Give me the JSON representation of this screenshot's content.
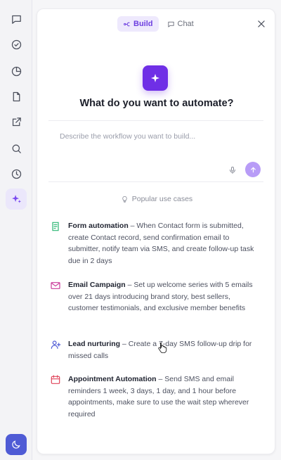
{
  "rail": {
    "items": [
      {
        "icon": "chat-bubble-icon"
      },
      {
        "icon": "check-circle-icon"
      },
      {
        "icon": "pie-chart-icon"
      },
      {
        "icon": "file-icon"
      },
      {
        "icon": "external-link-icon"
      },
      {
        "icon": "search-icon"
      },
      {
        "icon": "history-icon"
      },
      {
        "icon": "sparkles-icon",
        "active": true
      }
    ],
    "theme_icon": "moon-icon"
  },
  "panel": {
    "tabs": [
      {
        "label": "Build",
        "active": true,
        "icon": "build-icon"
      },
      {
        "label": "Chat",
        "active": false,
        "icon": "chat-icon"
      }
    ],
    "heading": "What do you want to automate?",
    "prompt_placeholder": "Describe the workflow you want to build...",
    "popular_label": "Popular use cases",
    "use_cases": [
      {
        "title": "Form automation",
        "description": " – When Contact form is submitted, create Contact record, send confirmation email to submitter, notify team via SMS, and create follow-up task due in 2 days",
        "icon": "form-icon",
        "color": "#2bb673"
      },
      {
        "title": "Email Campaign",
        "description": " – Set up welcome series with 5 emails over 21 days introducing brand story, best sellers, customer testimonials, and exclusive member benefits",
        "icon": "mail-icon",
        "color": "#c93a9a"
      },
      {
        "title": "Lead nurturing",
        "description": " – Create a 7-day SMS follow-up drip for missed calls",
        "icon": "user-plus-icon",
        "color": "#4f5bd5"
      },
      {
        "title": "Appointment Automation",
        "description": " – Send SMS and email reminders 1 week, 3 days, 1 day, and 1 hour before appointments, make sure to use the wait step wherever required",
        "icon": "calendar-icon",
        "color": "#e0445a"
      }
    ]
  },
  "colors": {
    "accent": "#6f2fe6",
    "accent_light": "#eee9fd",
    "send_button": "#b89cf7",
    "theme_button": "#4f5bd5"
  }
}
